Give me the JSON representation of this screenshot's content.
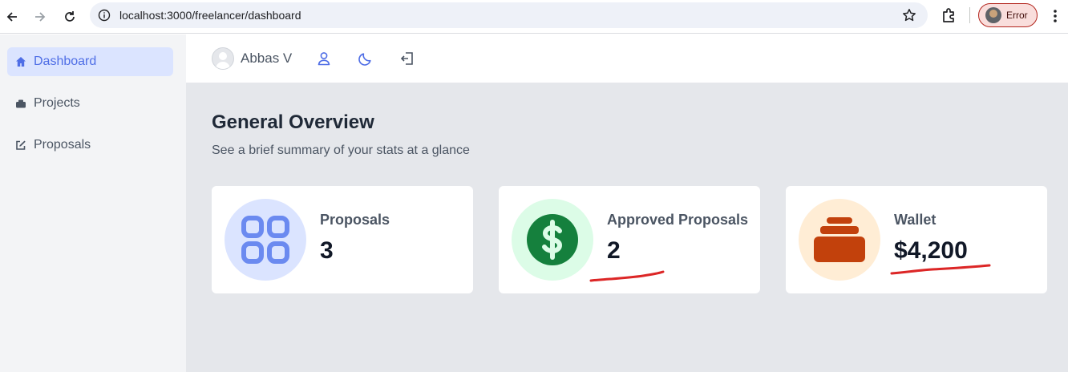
{
  "browser": {
    "url": "localhost:3000/freelancer/dashboard",
    "profile_label": "Error",
    "icons": [
      "back-arrow-icon",
      "forward-arrow-icon",
      "reload-icon",
      "site-info-icon",
      "bookmark-star-icon",
      "extensions-icon",
      "menu-kebab-icon"
    ]
  },
  "sidebar": {
    "items": [
      {
        "label": "Dashboard",
        "icon": "home-icon",
        "active": true
      },
      {
        "label": "Projects",
        "icon": "briefcase-icon",
        "active": false
      },
      {
        "label": "Proposals",
        "icon": "edit-icon",
        "active": false
      }
    ]
  },
  "topbar": {
    "user_name": "Abbas V",
    "icons": [
      "user-profile-icon",
      "dark-mode-moon-icon",
      "logout-icon"
    ]
  },
  "main": {
    "title": "General Overview",
    "subtitle": "See a brief summary of your stats at a glance"
  },
  "cards": [
    {
      "label": "Proposals",
      "value": "3",
      "icon": "grid-apps-icon",
      "circle_color": "#dbe4ff",
      "icon_color": "#6b8af0"
    },
    {
      "label": "Approved Proposals",
      "value": "2",
      "icon": "dollar-circle-icon",
      "circle_color": "#dcfce7",
      "icon_color": "#15803d"
    },
    {
      "label": "Wallet",
      "value": "$4,200",
      "icon": "wallet-stack-icon",
      "circle_color": "#ffedd5",
      "icon_color": "#c2410c"
    }
  ],
  "colors": {
    "accent": "#4f6ee6",
    "annotation_red": "#dc2626"
  }
}
